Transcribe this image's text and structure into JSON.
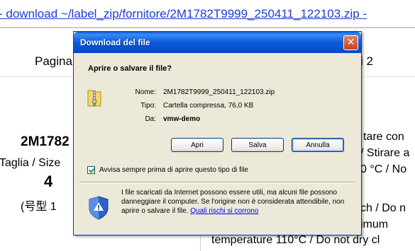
{
  "background": {
    "url_link": "- download ~/label_zip/fornitore/2M1782T9999_250411_122103.zip -",
    "texts": {
      "pagina": "Pagina",
      "page_suffix": "i 2",
      "product_code": "2M1782",
      "taglia": "Taglia / Size",
      "number": "4",
      "korean": "(号型 1",
      "stirare": "tare con",
      "stirare2": "/ Stirare a",
      "temp": "0 °C / No",
      "ch": "ch / Do n",
      "imum": "imum",
      "temperature_line": "temperature 110°C / Do not dry cl"
    }
  },
  "dialog": {
    "title": "Download del file",
    "close_glyph": "✕",
    "question": "Aprire o salvare il file?",
    "file_info": {
      "name_label": "Nome:",
      "name_value": "2M1782T9999_250411_122103.zip",
      "type_label": "Tipo:",
      "type_value": "Cartella compressa, 76,0 KB",
      "from_label": "Da:",
      "from_value": "vmw-demo"
    },
    "buttons": {
      "open": "Apri",
      "save": "Salva",
      "cancel": "Annulla"
    },
    "checkbox": {
      "label": "Avvisa sempre prima di aprire questo tipo di file",
      "checked": true
    },
    "warning": {
      "text": "I file scaricati da Internet possono essere utili, ma alcuni file possono danneggiare il computer. Se l'origine non è considerata attendibile, non aprire o salvare il file.",
      "link": "Quali rischi si corrono"
    },
    "icons": {
      "file": "zip-folder-icon",
      "warning": "security-shield-icon",
      "close": "close-icon"
    },
    "colors": {
      "titlebar": "#0a5ad6",
      "dialog_bg": "#ece9d8",
      "close_button": "#d4502c",
      "link": "#0000ee"
    }
  }
}
